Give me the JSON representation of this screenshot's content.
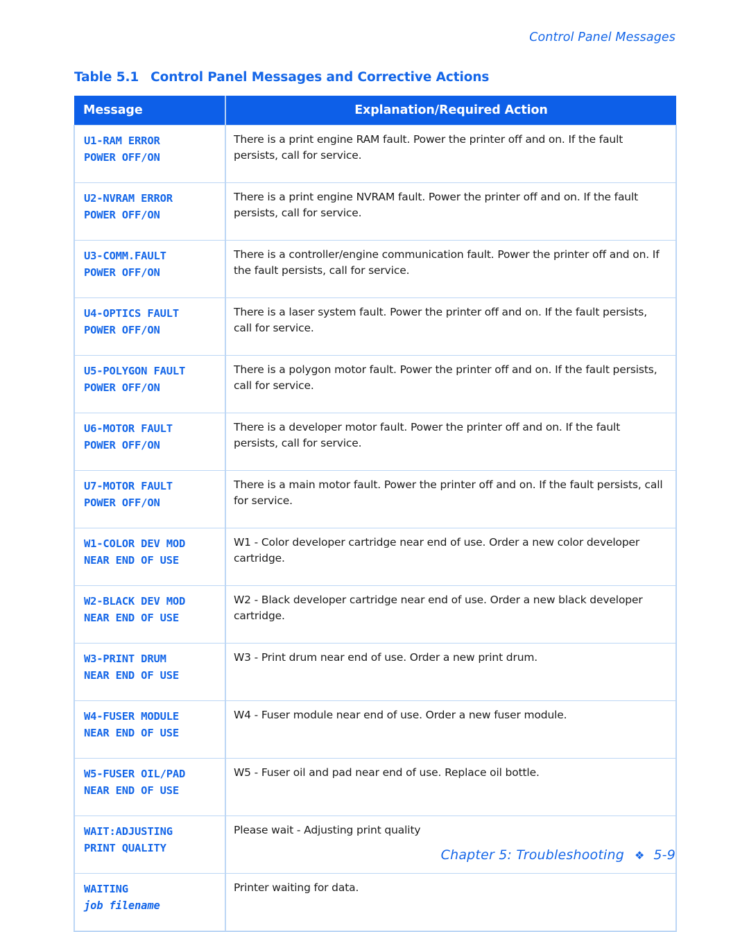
{
  "running_head": "Control Panel Messages",
  "table": {
    "caption_number": "Table 5.1",
    "caption_title": "Control Panel Messages and Corrective Actions",
    "headers": {
      "message": "Message",
      "explanation": "Explanation/Required Action"
    },
    "rows": [
      {
        "message_line1": "U1-RAM ERROR",
        "message_line2": "POWER OFF/ON",
        "explanation": "There is a print engine RAM fault. Power the printer off and on. If the fault persists, call for service."
      },
      {
        "message_line1": "U2-NVRAM ERROR",
        "message_line2": "POWER OFF/ON",
        "explanation": "There is a print engine NVRAM fault. Power the printer off and on. If the fault persists, call for service."
      },
      {
        "message_line1": "U3-COMM.FAULT",
        "message_line2": "POWER OFF/ON",
        "explanation": "There is a controller/engine communication fault. Power the printer off and on. If the fault persists, call for service."
      },
      {
        "message_line1": "U4-OPTICS FAULT",
        "message_line2": "POWER OFF/ON",
        "explanation": "There is a laser system fault. Power the printer off and on. If the fault persists, call for service."
      },
      {
        "message_line1": "U5-POLYGON FAULT",
        "message_line2": "POWER OFF/ON",
        "explanation": "There is a polygon motor fault. Power the printer off and on. If the fault persists, call for service."
      },
      {
        "message_line1": "U6-MOTOR FAULT",
        "message_line2": "POWER OFF/ON",
        "explanation": "There is a developer motor fault. Power the printer off and on. If the fault persists, call for service."
      },
      {
        "message_line1": "U7-MOTOR FAULT",
        "message_line2": "POWER OFF/ON",
        "explanation": "There is a main motor fault. Power the printer off and on. If the fault persists, call for service."
      },
      {
        "message_line1": "W1-COLOR DEV MOD",
        "message_line2": "NEAR END OF USE",
        "explanation": "W1 - Color developer cartridge near end of use. Order a new color developer cartridge."
      },
      {
        "message_line1": "W2-BLACK DEV MOD",
        "message_line2": "NEAR END OF USE",
        "explanation": "W2 - Black developer cartridge near end of use. Order a new black developer cartridge."
      },
      {
        "message_line1": "W3-PRINT DRUM",
        "message_line2": "NEAR END OF USE",
        "explanation": "W3 - Print drum near end of use. Order a new print drum."
      },
      {
        "message_line1": "W4-FUSER MODULE",
        "message_line2": "NEAR END OF USE",
        "explanation": "W4 - Fuser module near end of use. Order a new fuser module."
      },
      {
        "message_line1": "W5-FUSER OIL/PAD",
        "message_line2": "NEAR END OF USE",
        "explanation": "W5 - Fuser oil and pad near end of use. Replace oil bottle."
      },
      {
        "message_line1": "WAIT:ADJUSTING",
        "message_line2": "PRINT QUALITY",
        "explanation": "Please wait - Adjusting print quality"
      },
      {
        "message_line1": "WAITING",
        "message_line2": "job filename",
        "message_line2_italic": true,
        "explanation": "Printer waiting for data."
      }
    ]
  },
  "footer": {
    "chapter": "Chapter 5: Troubleshooting",
    "diamond": "❖",
    "page_number": "5-9"
  },
  "colors": {
    "accent_blue": "#1466e8",
    "header_blue": "#0d5fe8",
    "border_blue": "#bcd6f5",
    "body_text": "#1a1a1a"
  }
}
